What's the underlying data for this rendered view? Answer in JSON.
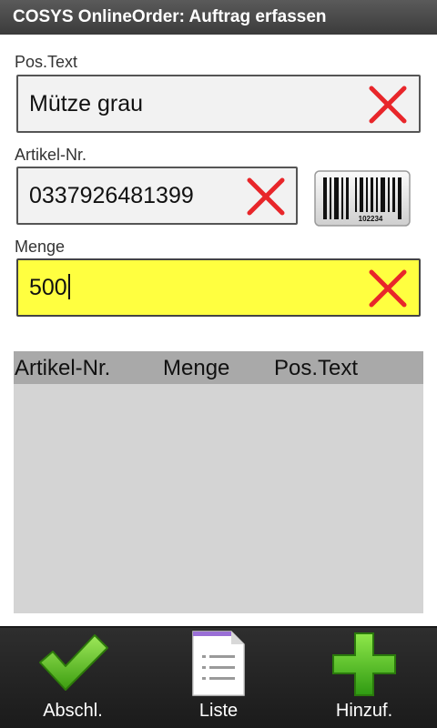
{
  "app": {
    "title": "COSYS OnlineOrder: Auftrag erfassen"
  },
  "form": {
    "pos_text": {
      "label": "Pos.Text",
      "value": "Mütze grau"
    },
    "artikel_nr": {
      "label": "Artikel-Nr.",
      "value": "0337926481399"
    },
    "menge": {
      "label": "Menge",
      "value": "500"
    },
    "barcode_number": "102234"
  },
  "table": {
    "headers": [
      "Artikel-Nr.",
      "Menge",
      "Pos.Text"
    ],
    "rows": []
  },
  "toolbar": {
    "finish_label": "Abschl.",
    "list_label": "Liste",
    "add_label": "Hinzuf."
  },
  "colors": {
    "active_field": "#ffff40",
    "clear_x": "#e8262a",
    "confirm_green": "#58c21a"
  },
  "icons": {
    "clear": "close-x-icon",
    "barcode": "barcode-icon",
    "finish": "checkmark-icon",
    "list": "list-document-icon",
    "add": "plus-icon"
  }
}
